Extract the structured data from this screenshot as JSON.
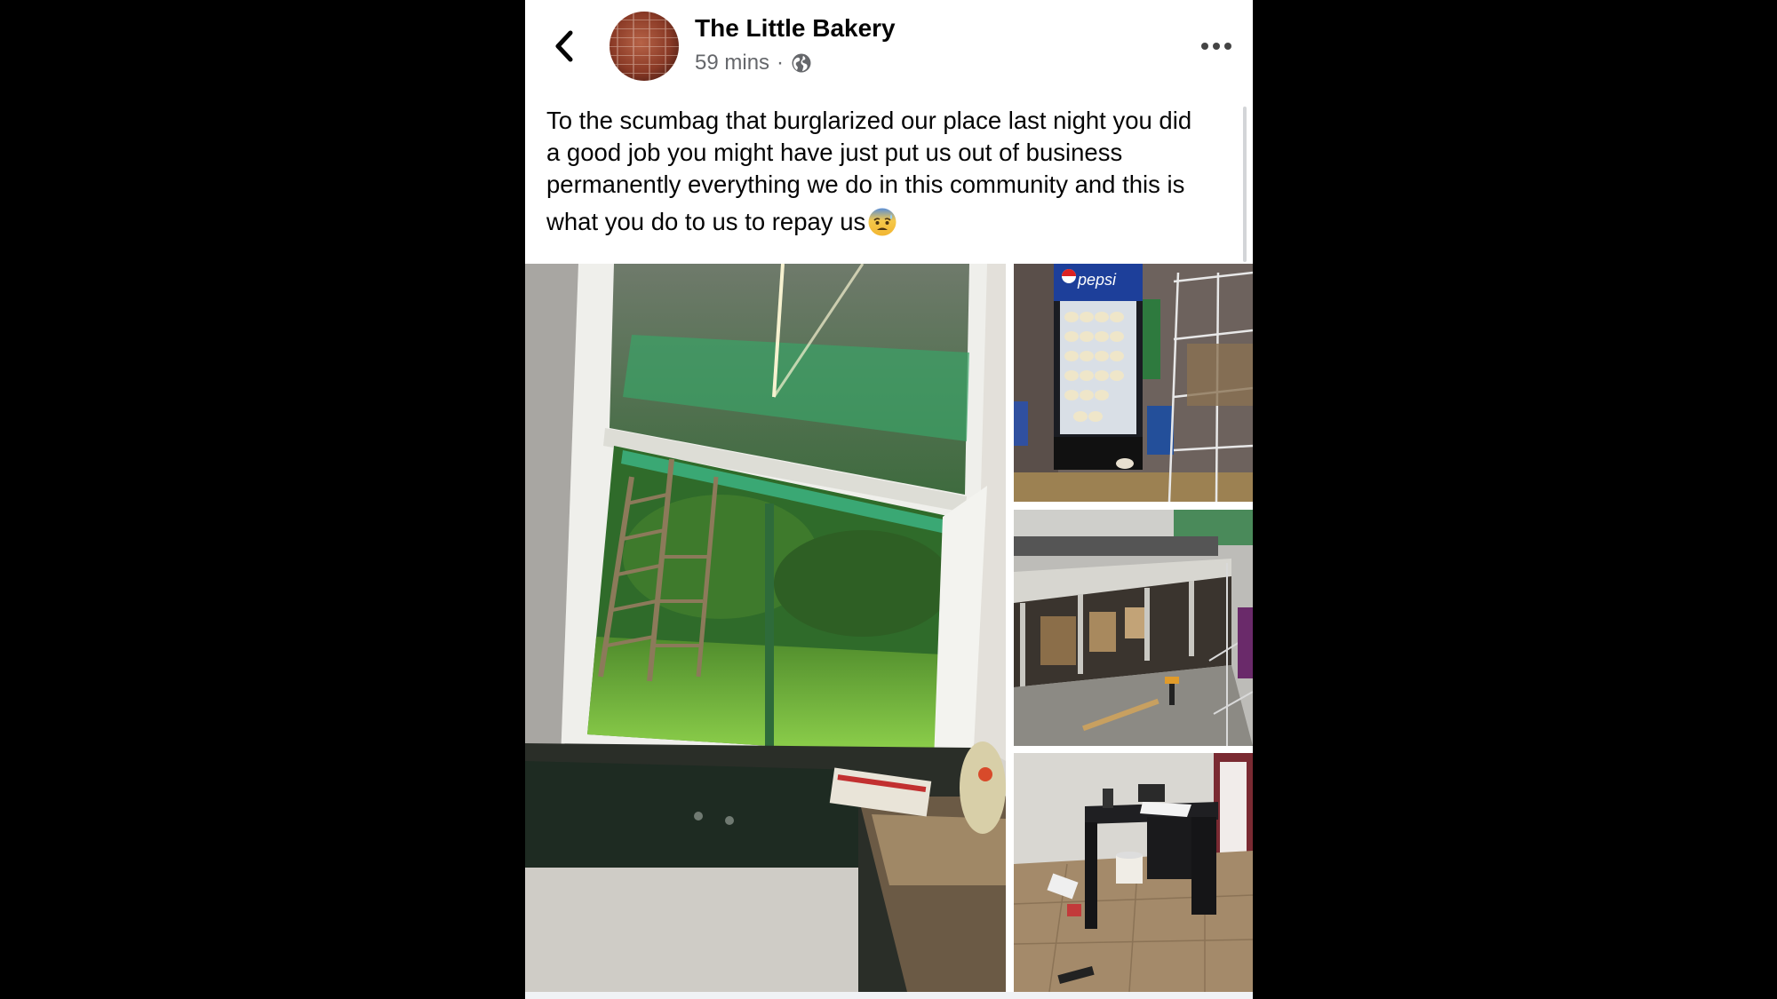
{
  "post": {
    "page_name": "The Little Bakery",
    "time": "59 mins",
    "separator": "·",
    "privacy_icon": "globe-icon",
    "text_lines": [
      "To the scumbag that burglarized our place last night you did",
      "a good job you might have just put us out of business",
      "permanently everything we do in this community and this is",
      "what you do to us to repay us"
    ],
    "emoji": "anxious-face-with-sweat-emoji"
  },
  "header": {
    "back_icon": "chevron-left-icon",
    "more_icon": "more-horizontal-icon"
  },
  "photos": {
    "fridge_brand": "pepsi"
  },
  "colors": {
    "text_primary": "#050505",
    "text_secondary": "#65676b",
    "background": "#ffffff",
    "letterbox": "#000000"
  }
}
